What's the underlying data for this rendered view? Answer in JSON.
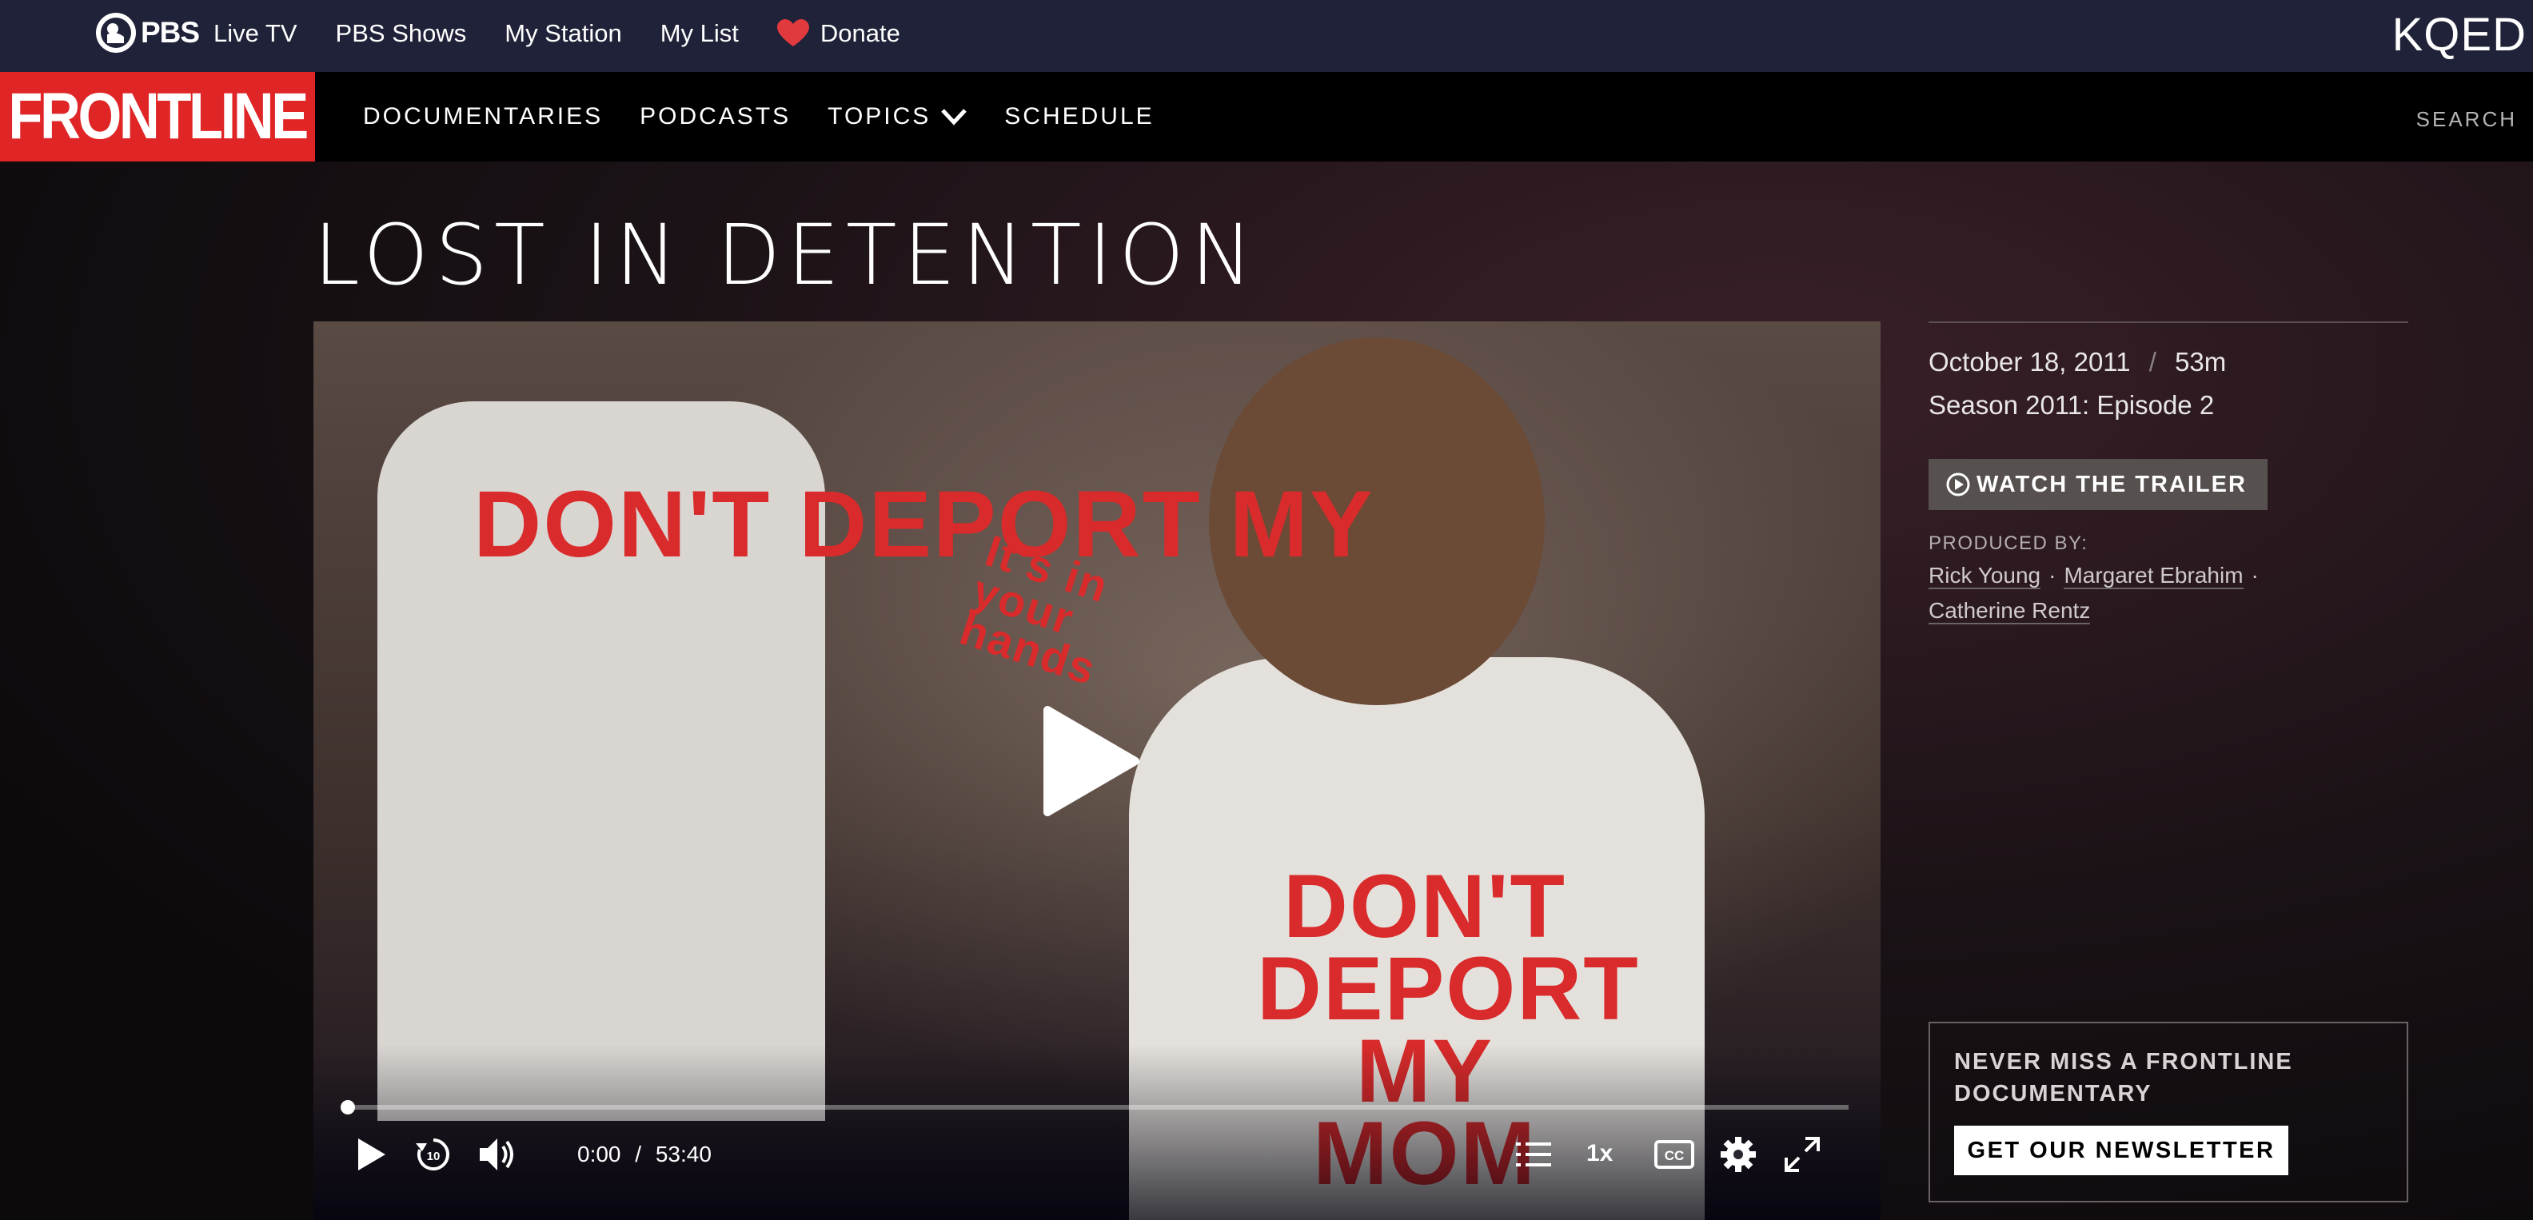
{
  "pbs_header": {
    "logo": "PBS",
    "nav": [
      "Live TV",
      "PBS Shows",
      "My Station",
      "My List"
    ],
    "donate": "Donate",
    "station": "KQED"
  },
  "frontline_header": {
    "logo": "FRONTLINE",
    "nav": [
      "DOCUMENTARIES",
      "PODCASTS",
      "TOPICS",
      "SCHEDULE"
    ],
    "search": "SEARCH"
  },
  "title": "LOST IN DETENTION",
  "player": {
    "sign_texts": [
      "DON'T DEPORT MY",
      "DON'T DEPORT MY MOM",
      "It's in your hands"
    ],
    "current_time": "0:00",
    "separator": "/",
    "duration": "53:40",
    "speed": "1x",
    "progress_fraction": 0.0
  },
  "details": {
    "date": "October 18, 2011",
    "separator": "/",
    "length": "53m",
    "season_episode": "Season 2011: Episode 2",
    "trailer_button": "WATCH THE TRAILER",
    "produced_by_label": "PRODUCED BY:",
    "producers": [
      "Rick Young",
      "Margaret Ebrahim",
      "Catherine Rentz"
    ]
  },
  "newsletter": {
    "heading": "NEVER MISS A FRONTLINE DOCUMENTARY",
    "button": "GET OUR NEWSLETTER"
  },
  "colors": {
    "frontline_red": "#e02527",
    "pbs_bar": "#1f2238",
    "donate_heart": "#e03a3e"
  }
}
